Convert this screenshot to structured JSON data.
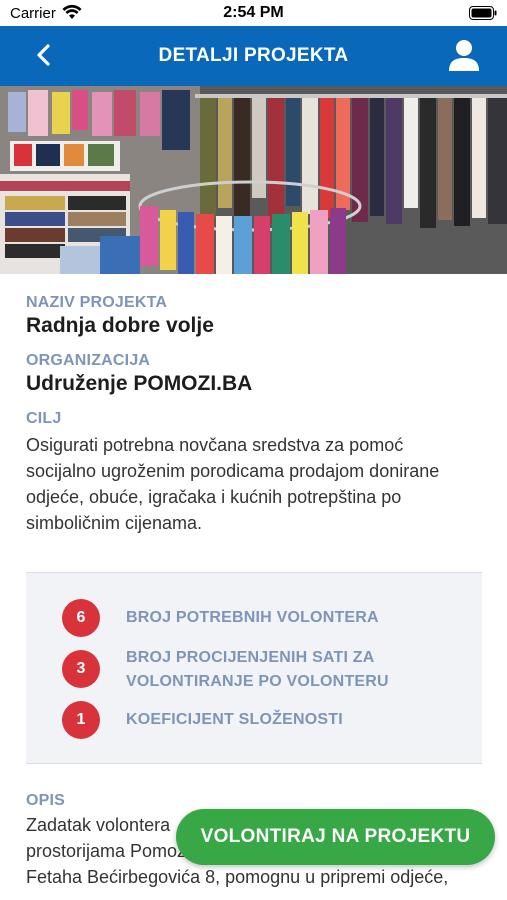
{
  "status_bar": {
    "carrier": "Carrier",
    "time": "2:54 PM"
  },
  "header": {
    "title": "DETALJI PROJEKTA",
    "back_icon": "chevron-left-icon",
    "profile_icon": "user-icon",
    "background_color": "#0a68ba"
  },
  "project": {
    "name_label": "NAZIV PROJEKTA",
    "name": "Radnja dobre volje",
    "organization_label": "ORGANIZACIJA",
    "organization": "Udruženje POMOZI.BA",
    "goal_label": "CILJ",
    "goal_lines": [
      "Osigurati potrebna novčana sredstva za pomoć",
      "socijalno ugroženim porodicama prodajom donirane",
      "odjeće, obuće, igračaka i kućnih potrepština po",
      "simboličnim cijenama."
    ]
  },
  "stats": [
    {
      "value": "6",
      "label_lines": [
        "BROJ POTREBNIH VOLONTERA"
      ]
    },
    {
      "value": "3",
      "label_lines": [
        "BROJ PROCIJENJENIH SATI ZA",
        "VOLONTIRANJE PO VOLONTERU"
      ]
    },
    {
      "value": "1",
      "label_lines": [
        "KOEFICIJENT SLOŽENOSTI"
      ]
    }
  ],
  "description": {
    "label": "OPIS",
    "lines": [
      "Zadatak volontera",
      "prostorijama Pomoz",
      "Fetaha Bećirbegovića 8, pomognu u pripremi odjeće,"
    ]
  },
  "cta": {
    "label": "VOLONTIRAJ NA PROJEKTU",
    "color": "#37a845"
  },
  "colors": {
    "label": "#7d95b8",
    "badge": "#d8333a"
  }
}
